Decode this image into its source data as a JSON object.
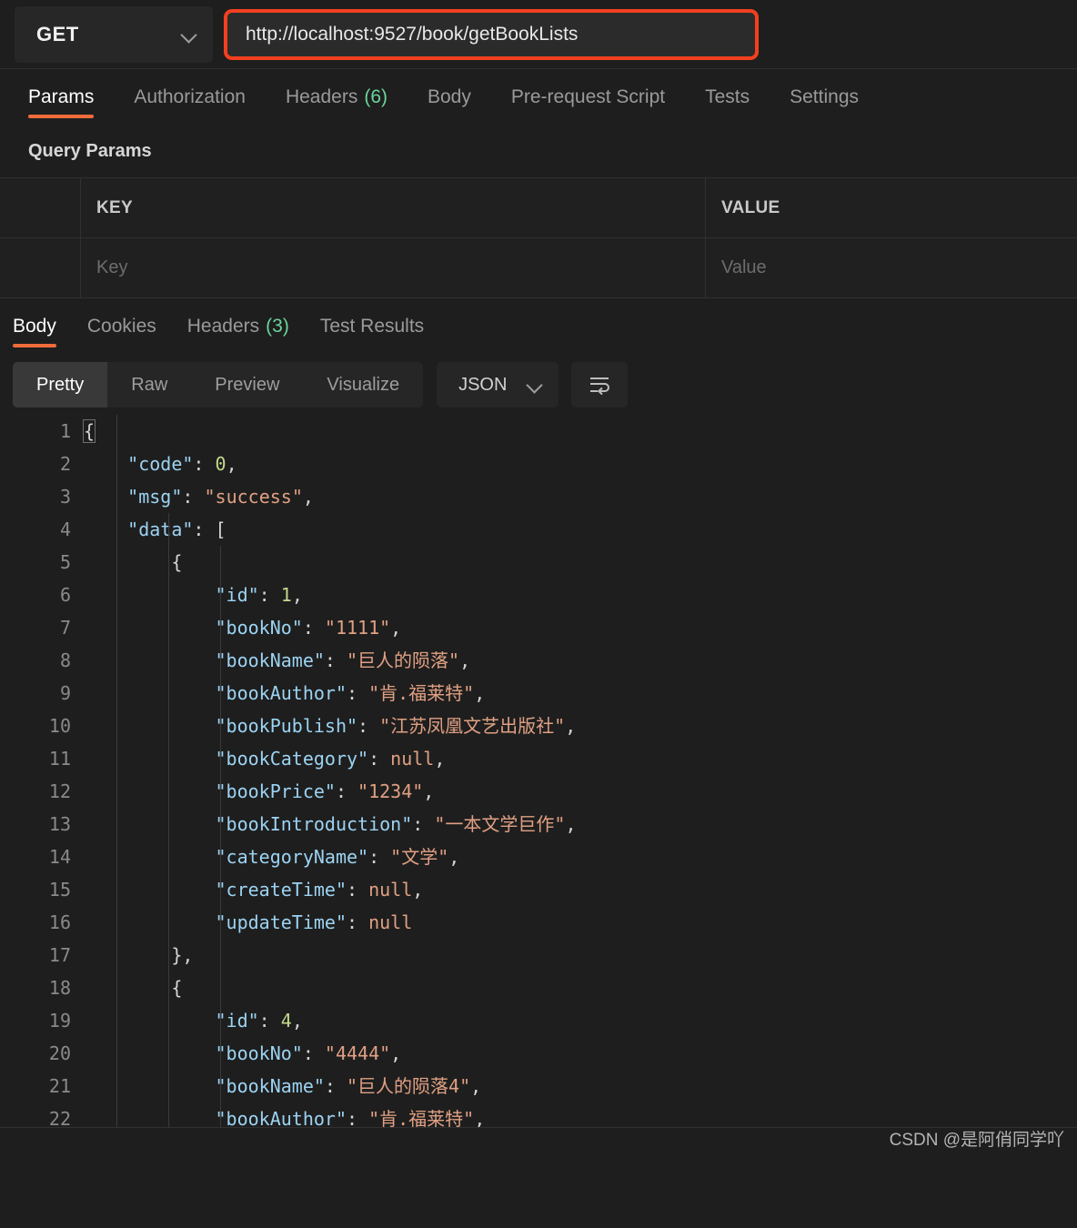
{
  "request_bar": {
    "method": "GET",
    "method_dropdown_icon": "chevron-down-icon",
    "url": "http://localhost:9527/book/getBookLists"
  },
  "request_tabs": [
    {
      "label": "Params",
      "count": "",
      "active": true
    },
    {
      "label": "Authorization",
      "count": "",
      "active": false
    },
    {
      "label": "Headers",
      "count": "(6)",
      "active": false
    },
    {
      "label": "Body",
      "count": "",
      "active": false
    },
    {
      "label": "Pre-request Script",
      "count": "",
      "active": false
    },
    {
      "label": "Tests",
      "count": "",
      "active": false
    },
    {
      "label": "Settings",
      "count": "",
      "active": false
    }
  ],
  "query_params": {
    "section_title": "Query Params",
    "columns": [
      "KEY",
      "VALUE"
    ],
    "placeholder_row": {
      "key": "Key",
      "value": "Value"
    }
  },
  "response_tabs": [
    {
      "label": "Body",
      "count": "",
      "active": true
    },
    {
      "label": "Cookies",
      "count": "",
      "active": false
    },
    {
      "label": "Headers",
      "count": "(3)",
      "active": false
    },
    {
      "label": "Test Results",
      "count": "",
      "active": false
    }
  ],
  "view_toolbar": {
    "segments": [
      {
        "label": "Pretty",
        "active": true
      },
      {
        "label": "Raw",
        "active": false
      },
      {
        "label": "Preview",
        "active": false
      },
      {
        "label": "Visualize",
        "active": false
      }
    ],
    "format": "JSON",
    "format_dropdown_icon": "chevron-down-icon",
    "wrap_icon": "word-wrap-icon"
  },
  "response_body": {
    "language": "json",
    "lines": [
      {
        "n": "1",
        "tokens": [
          {
            "t": "{",
            "c": "punct"
          }
        ]
      },
      {
        "n": "2",
        "tokens": [
          {
            "t": "    ",
            "c": "punct"
          },
          {
            "t": "\"code\"",
            "c": "key"
          },
          {
            "t": ": ",
            "c": "punct"
          },
          {
            "t": "0",
            "c": "num"
          },
          {
            "t": ",",
            "c": "punct"
          }
        ]
      },
      {
        "n": "3",
        "tokens": [
          {
            "t": "    ",
            "c": "punct"
          },
          {
            "t": "\"msg\"",
            "c": "key"
          },
          {
            "t": ": ",
            "c": "punct"
          },
          {
            "t": "\"success\"",
            "c": "str"
          },
          {
            "t": ",",
            "c": "punct"
          }
        ]
      },
      {
        "n": "4",
        "tokens": [
          {
            "t": "    ",
            "c": "punct"
          },
          {
            "t": "\"data\"",
            "c": "key"
          },
          {
            "t": ": [",
            "c": "punct"
          }
        ]
      },
      {
        "n": "5",
        "tokens": [
          {
            "t": "        {",
            "c": "punct"
          }
        ]
      },
      {
        "n": "6",
        "tokens": [
          {
            "t": "            ",
            "c": "punct"
          },
          {
            "t": "\"id\"",
            "c": "key"
          },
          {
            "t": ": ",
            "c": "punct"
          },
          {
            "t": "1",
            "c": "num"
          },
          {
            "t": ",",
            "c": "punct"
          }
        ]
      },
      {
        "n": "7",
        "tokens": [
          {
            "t": "            ",
            "c": "punct"
          },
          {
            "t": "\"bookNo\"",
            "c": "key"
          },
          {
            "t": ": ",
            "c": "punct"
          },
          {
            "t": "\"1111\"",
            "c": "str"
          },
          {
            "t": ",",
            "c": "punct"
          }
        ]
      },
      {
        "n": "8",
        "tokens": [
          {
            "t": "            ",
            "c": "punct"
          },
          {
            "t": "\"bookName\"",
            "c": "key"
          },
          {
            "t": ": ",
            "c": "punct"
          },
          {
            "t": "\"巨人的陨落\"",
            "c": "str"
          },
          {
            "t": ",",
            "c": "punct"
          }
        ]
      },
      {
        "n": "9",
        "tokens": [
          {
            "t": "            ",
            "c": "punct"
          },
          {
            "t": "\"bookAuthor\"",
            "c": "key"
          },
          {
            "t": ": ",
            "c": "punct"
          },
          {
            "t": "\"肯.福莱特\"",
            "c": "str"
          },
          {
            "t": ",",
            "c": "punct"
          }
        ]
      },
      {
        "n": "10",
        "tokens": [
          {
            "t": "            ",
            "c": "punct"
          },
          {
            "t": "\"bookPublish\"",
            "c": "key"
          },
          {
            "t": ": ",
            "c": "punct"
          },
          {
            "t": "\"江苏凤凰文艺出版社\"",
            "c": "str"
          },
          {
            "t": ",",
            "c": "punct"
          }
        ]
      },
      {
        "n": "11",
        "tokens": [
          {
            "t": "            ",
            "c": "punct"
          },
          {
            "t": "\"bookCategory\"",
            "c": "key"
          },
          {
            "t": ": ",
            "c": "punct"
          },
          {
            "t": "null",
            "c": "null"
          },
          {
            "t": ",",
            "c": "punct"
          }
        ]
      },
      {
        "n": "12",
        "tokens": [
          {
            "t": "            ",
            "c": "punct"
          },
          {
            "t": "\"bookPrice\"",
            "c": "key"
          },
          {
            "t": ": ",
            "c": "punct"
          },
          {
            "t": "\"1234\"",
            "c": "str"
          },
          {
            "t": ",",
            "c": "punct"
          }
        ]
      },
      {
        "n": "13",
        "tokens": [
          {
            "t": "            ",
            "c": "punct"
          },
          {
            "t": "\"bookIntroduction\"",
            "c": "key"
          },
          {
            "t": ": ",
            "c": "punct"
          },
          {
            "t": "\"一本文学巨作\"",
            "c": "str"
          },
          {
            "t": ",",
            "c": "punct"
          }
        ]
      },
      {
        "n": "14",
        "tokens": [
          {
            "t": "            ",
            "c": "punct"
          },
          {
            "t": "\"categoryName\"",
            "c": "key"
          },
          {
            "t": ": ",
            "c": "punct"
          },
          {
            "t": "\"文学\"",
            "c": "str"
          },
          {
            "t": ",",
            "c": "punct"
          }
        ]
      },
      {
        "n": "15",
        "tokens": [
          {
            "t": "            ",
            "c": "punct"
          },
          {
            "t": "\"createTime\"",
            "c": "key"
          },
          {
            "t": ": ",
            "c": "punct"
          },
          {
            "t": "null",
            "c": "null"
          },
          {
            "t": ",",
            "c": "punct"
          }
        ]
      },
      {
        "n": "16",
        "tokens": [
          {
            "t": "            ",
            "c": "punct"
          },
          {
            "t": "\"updateTime\"",
            "c": "key"
          },
          {
            "t": ": ",
            "c": "punct"
          },
          {
            "t": "null",
            "c": "null"
          }
        ]
      },
      {
        "n": "17",
        "tokens": [
          {
            "t": "        },",
            "c": "punct"
          }
        ]
      },
      {
        "n": "18",
        "tokens": [
          {
            "t": "        {",
            "c": "punct"
          }
        ]
      },
      {
        "n": "19",
        "tokens": [
          {
            "t": "            ",
            "c": "punct"
          },
          {
            "t": "\"id\"",
            "c": "key"
          },
          {
            "t": ": ",
            "c": "punct"
          },
          {
            "t": "4",
            "c": "num"
          },
          {
            "t": ",",
            "c": "punct"
          }
        ]
      },
      {
        "n": "20",
        "tokens": [
          {
            "t": "            ",
            "c": "punct"
          },
          {
            "t": "\"bookNo\"",
            "c": "key"
          },
          {
            "t": ": ",
            "c": "punct"
          },
          {
            "t": "\"4444\"",
            "c": "str"
          },
          {
            "t": ",",
            "c": "punct"
          }
        ]
      },
      {
        "n": "21",
        "tokens": [
          {
            "t": "            ",
            "c": "punct"
          },
          {
            "t": "\"bookName\"",
            "c": "key"
          },
          {
            "t": ": ",
            "c": "punct"
          },
          {
            "t": "\"巨人的陨落4\"",
            "c": "str"
          },
          {
            "t": ",",
            "c": "punct"
          }
        ]
      },
      {
        "n": "22",
        "tokens": [
          {
            "t": "            ",
            "c": "punct"
          },
          {
            "t": "\"bookAuthor\"",
            "c": "key"
          },
          {
            "t": ": ",
            "c": "punct"
          },
          {
            "t": "\"肯.福莱特\"",
            "c": "str"
          },
          {
            "t": ",",
            "c": "punct"
          }
        ]
      }
    ]
  },
  "watermark": "CSDN @是阿俏同学吖",
  "colors": {
    "accent_orange": "#ef6c3a",
    "annotation_red": "#f2401f",
    "count_green": "#6bd49a",
    "json_key": "#9cd3f2",
    "json_string": "#e0a083",
    "json_number": "#c3d98b",
    "background": "#1e1e1e"
  }
}
